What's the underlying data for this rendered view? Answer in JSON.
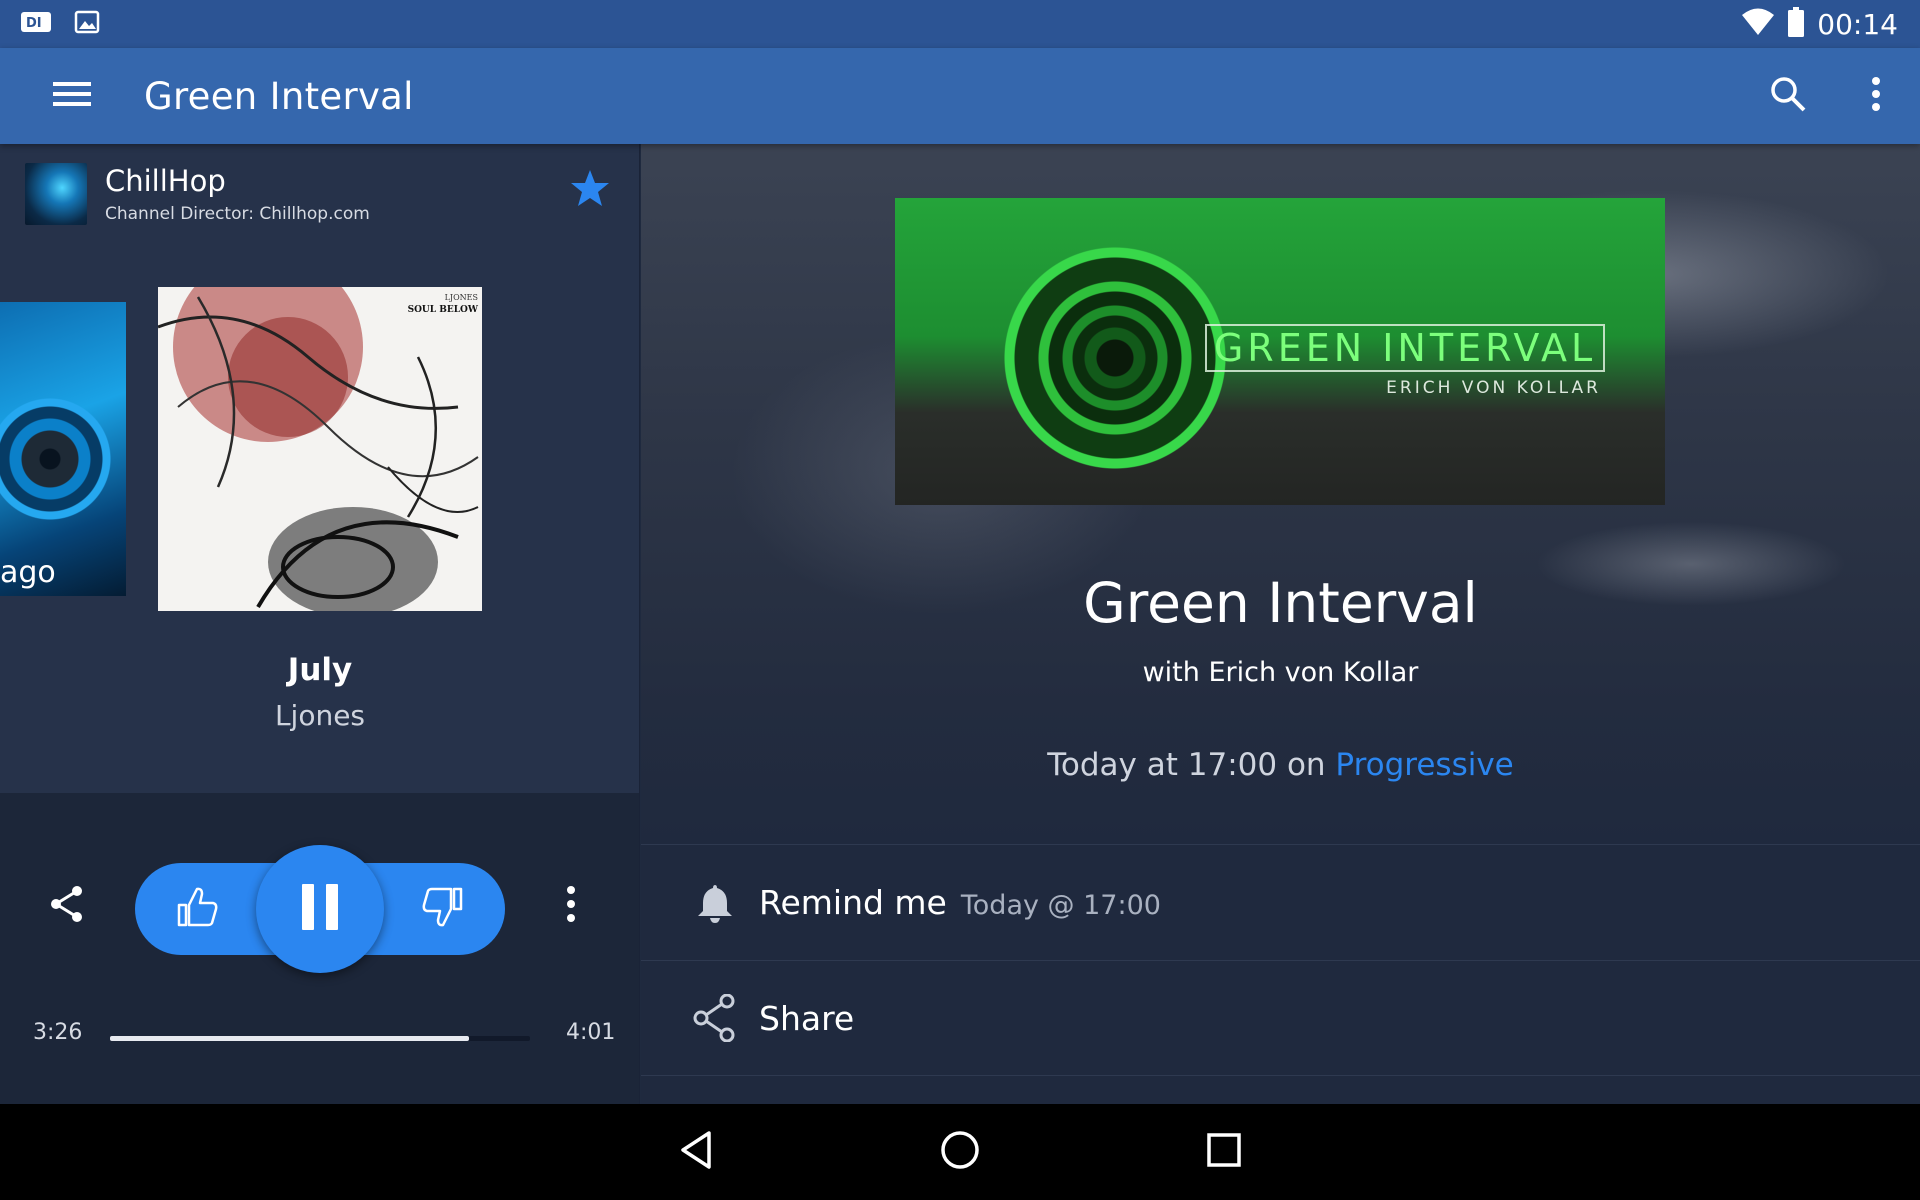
{
  "status_bar": {
    "left_icons": [
      "di-notification-icon",
      "image-notification-icon"
    ],
    "right_icons": [
      "wifi-icon",
      "battery-icon"
    ],
    "time": "00:14"
  },
  "app_bar": {
    "title": "Green Interval",
    "icons": [
      "menu-icon",
      "search-icon",
      "overflow-menu-icon"
    ],
    "color": "#3567ad"
  },
  "now_playing": {
    "channel": {
      "name": "ChillHop",
      "director": "Channel Director: Chillhop.com",
      "favorited": true
    },
    "previous_caption": "ago",
    "album_art_text": [
      "LJONES",
      "SOUL BELOW"
    ],
    "track": {
      "title": "July",
      "artist": "Ljones"
    },
    "controls": {
      "icons": [
        "share-icon",
        "thumbs-up-icon",
        "pause-icon",
        "thumbs-down-icon",
        "more-icon"
      ]
    },
    "progress": {
      "elapsed": "3:26",
      "total": "4:01",
      "fraction": 0.855
    }
  },
  "show": {
    "banner_title": "GREEN INTERVAL",
    "banner_subtitle": "ERICH VON KOLLAR",
    "title": "Green Interval",
    "host": "with Erich von Kollar",
    "time_prefix": "Today at 17:00 on ",
    "channel": "Progressive"
  },
  "actions": {
    "remind": {
      "label": "Remind me",
      "sub": "Today @ 17:00",
      "icon": "bell-icon"
    },
    "share": {
      "label": "Share",
      "icon": "share-icon"
    }
  },
  "nav_bar": {
    "icons": [
      "back-icon",
      "home-icon",
      "recents-icon"
    ]
  },
  "colors": {
    "accent": "#2b86f0",
    "panel": "#26324a",
    "background": "#1f293e"
  }
}
